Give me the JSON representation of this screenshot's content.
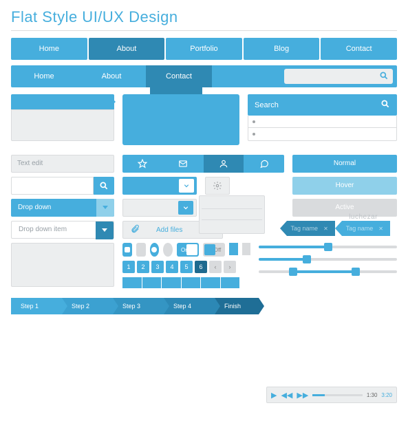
{
  "title": "Flat Style UI/UX Design",
  "nav1": {
    "items": [
      "Home",
      "About",
      "Portfolio",
      "Blog",
      "Contact"
    ],
    "active": 1
  },
  "nav2": {
    "items": [
      "Home",
      "About",
      "Contact"
    ],
    "active": 2
  },
  "search_panel": {
    "label": "Search"
  },
  "text_edit": {
    "placeholder": "Text edit"
  },
  "buttons": {
    "normal": "Normal",
    "hover": "Hover",
    "active": "Active"
  },
  "dropdown": {
    "label": "Drop down",
    "item": "Drop down item"
  },
  "addfiles": {
    "label": "Add files"
  },
  "tags": {
    "a": "Tag name",
    "b": "Tag name"
  },
  "toggles": {
    "on": "On",
    "off": "Off"
  },
  "pagination": [
    "1",
    "2",
    "3",
    "4",
    "5",
    "6"
  ],
  "steps": [
    "Step 1",
    "Step 2",
    "Step 3",
    "Step 4",
    "Finish"
  ],
  "player": {
    "current": "1:30",
    "total": "3:20"
  },
  "watermark": "luchezar",
  "sliders": {
    "a": 50,
    "b": 35,
    "c_lo": 25,
    "c_hi": 70
  },
  "colors": {
    "primary": "#46aedd",
    "primary_dark": "#2f89b3",
    "grey": "#d9dbdd"
  }
}
